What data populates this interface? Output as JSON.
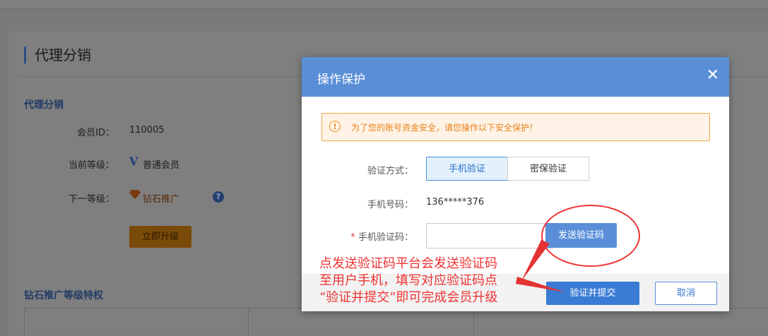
{
  "page": {
    "section_title": "代理分销",
    "subhead": "代理分销",
    "member_id_label": "会员ID：",
    "member_id_value": "110005",
    "current_level_label": "当前等级：",
    "current_level_icon": "V",
    "current_level_value": "普通会员",
    "next_level_label": "下一等级：",
    "next_level_value": "钻石推广",
    "help_icon": "?",
    "upgrade_button": "立即升级",
    "benefits_title": "钻石推广等级特权"
  },
  "modal": {
    "title": "操作保护",
    "close_icon": "✕",
    "notice_icon": "!",
    "notice_text": "为了您的账号资金安全，请您操作以下安全保护！",
    "verify_method_label": "验证方式：",
    "method_options": [
      "手机验证",
      "密保验证"
    ],
    "selected_method": "手机验证",
    "phone_label": "手机号码：",
    "phone_value": "136*****376",
    "code_required_mark": "*",
    "code_label": "手机验证码：",
    "code_value": "",
    "send_code_button": "发送验证码",
    "submit_button": "验证并提交",
    "cancel_button": "取消"
  },
  "annotation": {
    "line1": "点发送验证码平台会发送验证码",
    "line2": "至用户手机，填写对应验证码点",
    "line3": "“验证并提交”即可完成会员升级",
    "color": "#e33333"
  }
}
